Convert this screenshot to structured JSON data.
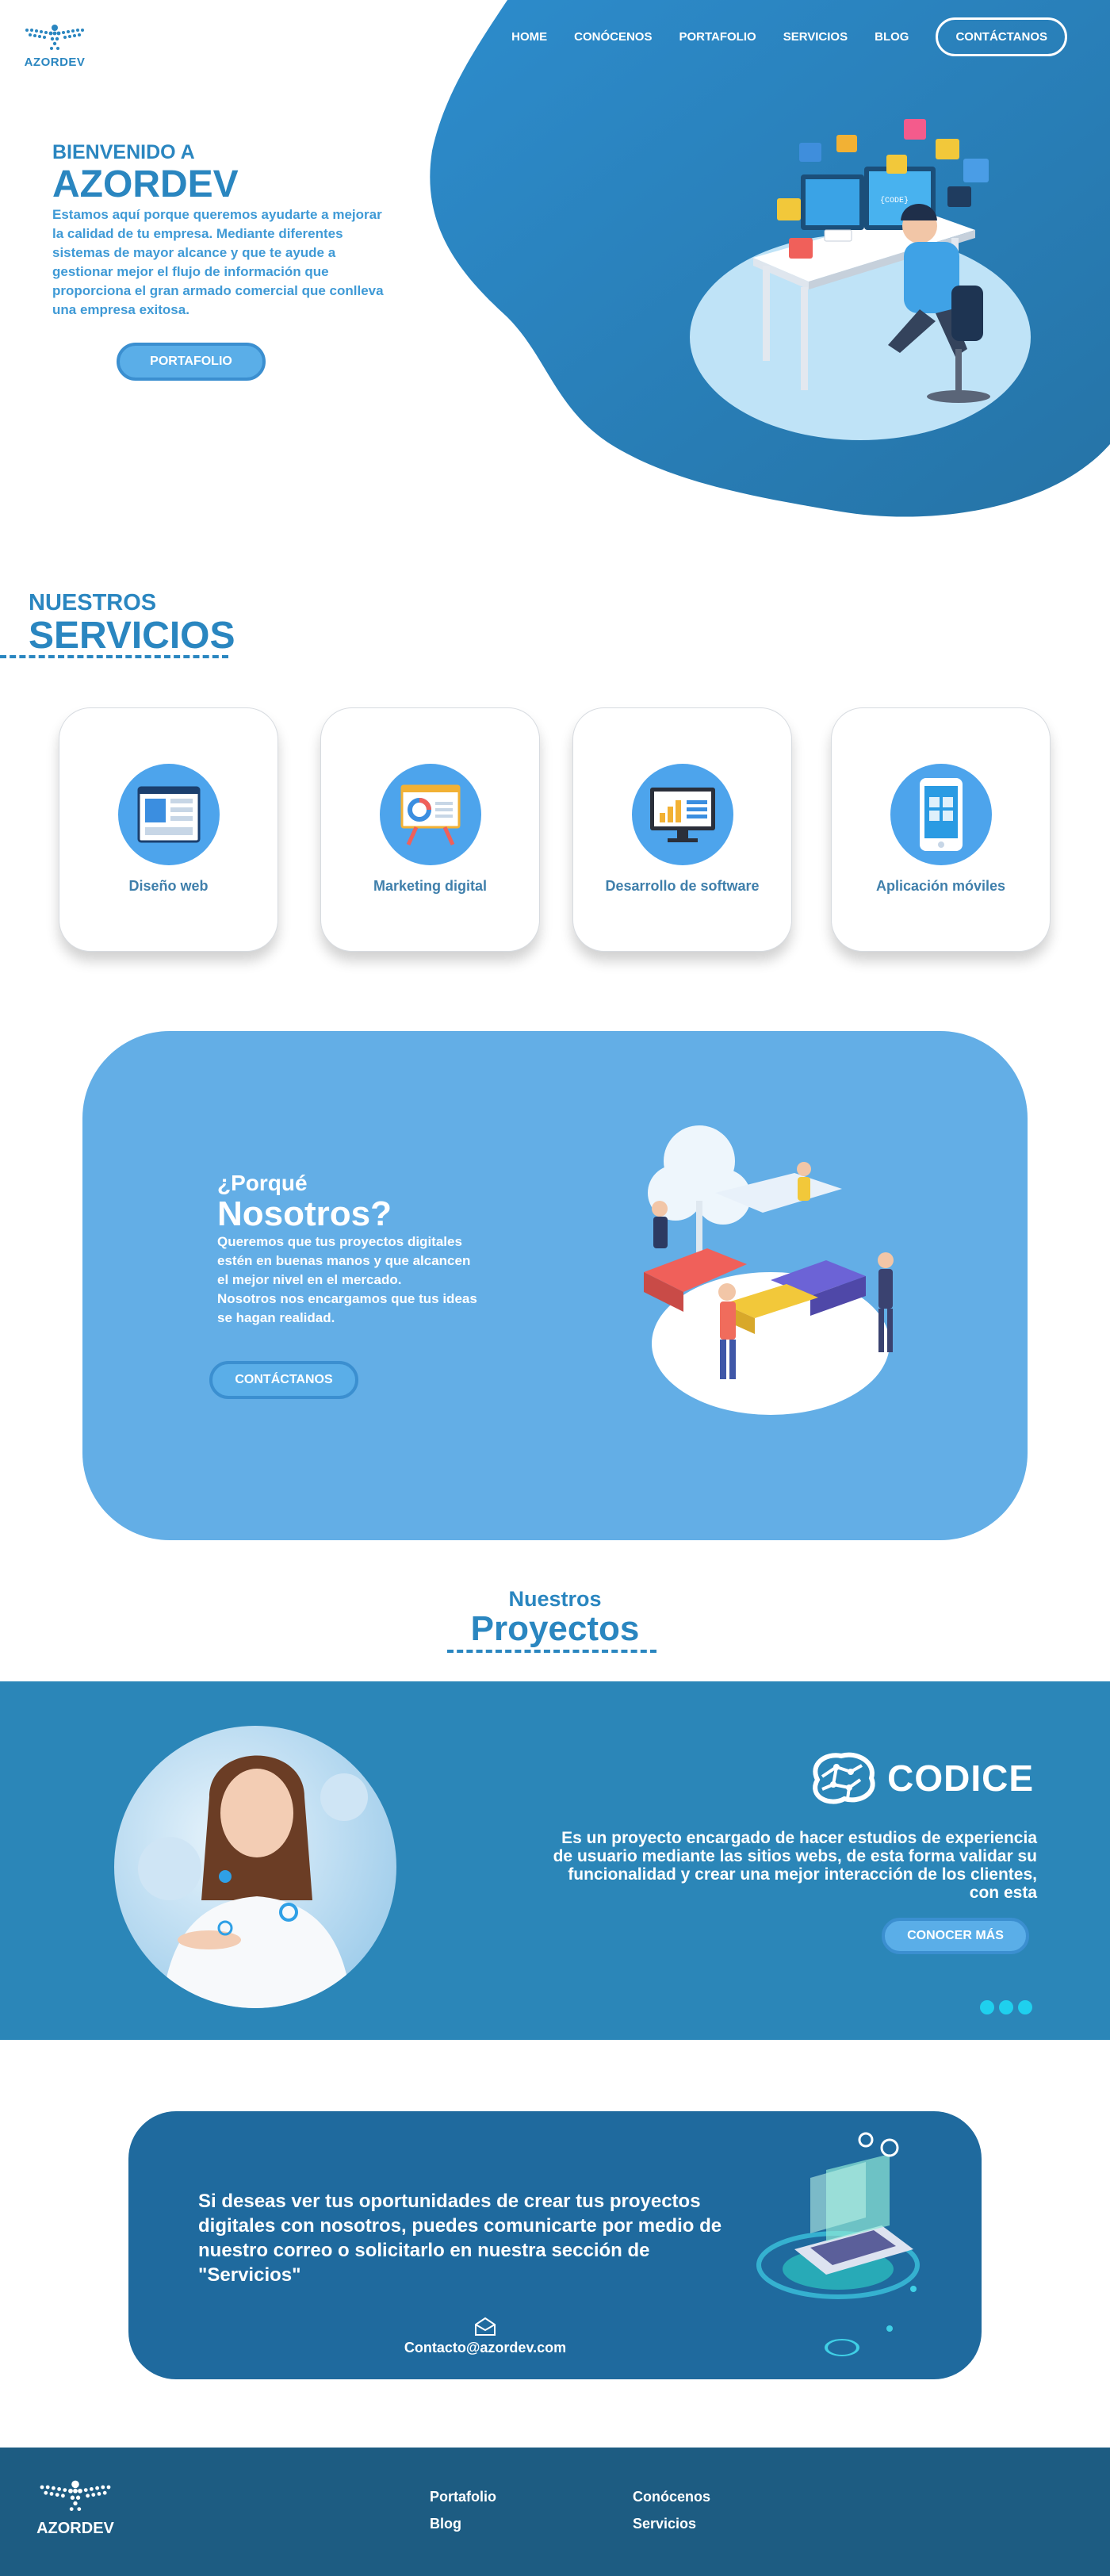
{
  "brand": {
    "name": "AZORDEV"
  },
  "nav": {
    "items": [
      "HOME",
      "CONÓCENOS",
      "PORTAFOLIO",
      "SERVICIOS",
      "BLOG"
    ],
    "cta": "CONTÁCTANOS"
  },
  "hero": {
    "kicker": "BIENVENIDO A",
    "title": "AZORDEV",
    "body": "Estamos aquí porque queremos ayudarte a mejorar la calidad de tu empresa. Mediante diferentes sistemas de mayor alcance y que te ayude a gestionar mejor el flujo de información que proporciona el gran armado comercial que conlleva una empresa exitosa.",
    "button": "PORTAFOLIO"
  },
  "services": {
    "title_small": "NUESTROS",
    "title_big": "SERVICIOS",
    "cards": [
      {
        "label": "Diseño web",
        "icon": "web-design-icon"
      },
      {
        "label": "Marketing digital",
        "icon": "presentation-board-icon"
      },
      {
        "label": "Desarrollo de software",
        "icon": "monitor-chart-icon"
      },
      {
        "label": "Aplicación móviles",
        "icon": "mobile-app-icon"
      }
    ]
  },
  "why": {
    "kicker": "¿Porqué",
    "title": "Nosotros?",
    "body1": "Queremos que tus proyectos digitales estén en buenas manos y que alcancen el mejor nivel en el mercado.",
    "body2": "Nosotros nos encargamos que tus ideas se hagan realidad.",
    "button": "CONTÁCTANOS"
  },
  "projects": {
    "title_small": "Nuestros",
    "title_big": "Proyectos",
    "logo_text": "CODICE",
    "description": "Es un proyecto encargado  de  hacer estudios de experiencia de usuario mediante las sitios webs, de esta forma validar su funcionalidad y crear una mejor interacción de los clientes, con esta",
    "button": "CONOCER MÁS",
    "slides": 3
  },
  "contact": {
    "text": "Si deseas ver tus oportunidades de crear tus proyectos digitales con nosotros, puedes comunicarte por medio de nuestro correo o solicitarlo en nuestra sección de \"Servicios\"",
    "email": "Contacto@azordev.com"
  },
  "footer": {
    "links": [
      "Portafolio",
      "Blog",
      "Conócenos",
      "Servicios"
    ],
    "brand": "AZORDEV"
  },
  "colors": {
    "primary": "#2a86c0",
    "light_blue": "#63aee6",
    "band": "#2b86b8",
    "contact_bg": "#1f6a9e",
    "footer_bg": "#1d5c82",
    "accent_dots": "#1fd0ee"
  }
}
